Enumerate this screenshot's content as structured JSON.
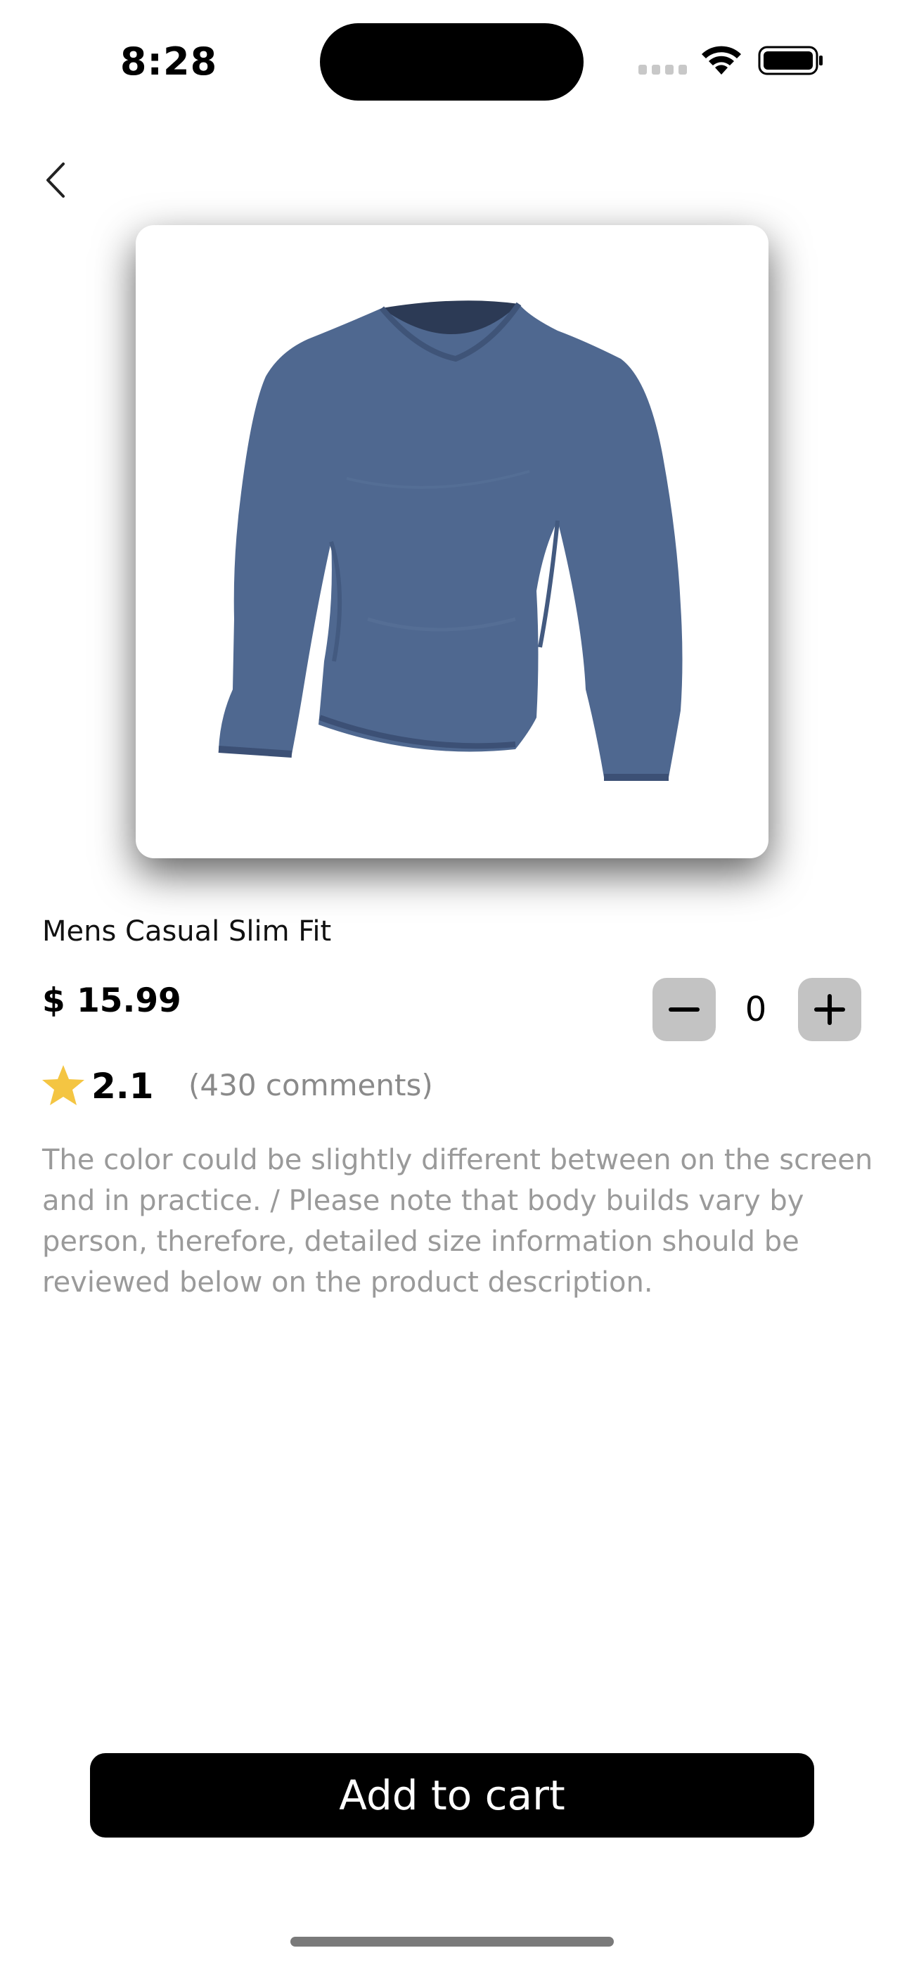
{
  "status_bar": {
    "time": "8:28",
    "icons": [
      "cellular-signal-icon",
      "wifi-icon",
      "battery-icon"
    ]
  },
  "navigation": {
    "back_icon": "chevron-left-icon"
  },
  "product": {
    "image_icon": "long-sleeve-shirt-image",
    "shirt_color": "#4f6890",
    "title": "Mens Casual Slim Fit",
    "price": "$ 15.99",
    "quantity": "0",
    "rating": "2.1",
    "comments": "(430 comments)",
    "star_color": "#f4c542",
    "description": "The color could be slightly different between on the screen\nand in practice. / Please note that body builds vary by\nperson, therefore, detailed size information should be\nreviewed below on the product description."
  },
  "actions": {
    "add_to_cart_label": "Add to cart"
  }
}
